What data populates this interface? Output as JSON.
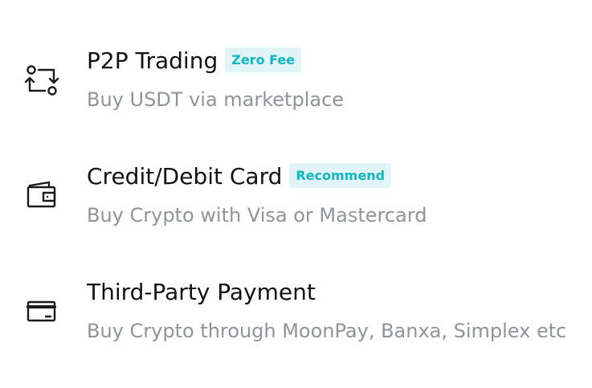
{
  "options": [
    {
      "icon": "p2p-exchange-icon",
      "title": "P2P Trading",
      "badge": "Zero Fee",
      "subtitle": "Buy USDT via marketplace"
    },
    {
      "icon": "wallet-icon",
      "title": "Credit/Debit Card",
      "badge": "Recommend",
      "subtitle": "Buy Crypto with Visa or Mastercard"
    },
    {
      "icon": "card-icon",
      "title": "Third-Party Payment",
      "subtitle": "Buy Crypto through MoonPay, Banxa, Simplex etc"
    }
  ],
  "colors": {
    "title": "#121212",
    "subtitle": "#8d9597",
    "badge_text": "#12b6c2",
    "badge_bg": "#e2f5f6",
    "icon": "#1a1a1a"
  }
}
